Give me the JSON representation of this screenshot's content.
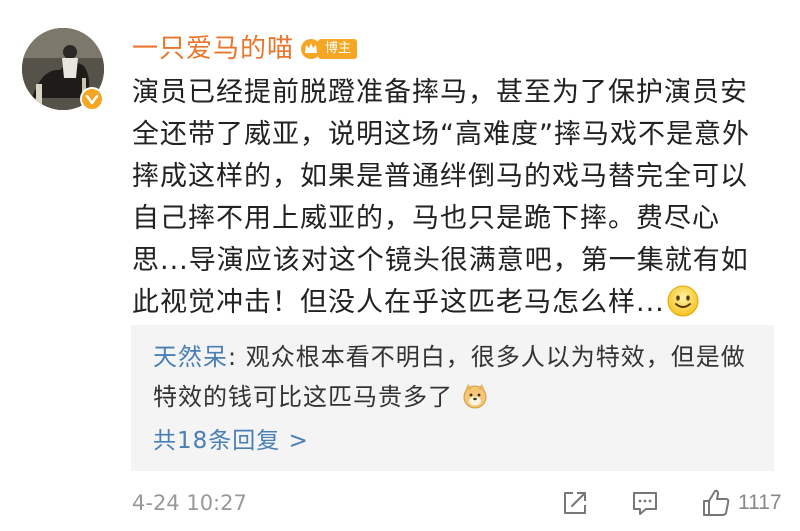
{
  "user": {
    "name": "一只爱马的喵",
    "badge_label": "博主"
  },
  "comment": {
    "text": "演员已经提前脱蹬准备摔马，甚至为了保护演员安全还带了威亚，说明这场“高难度”摔马戏不是意外摔成这样的，如果是普通绊倒马的戏马替完全可以自己摔不用上威亚的，马也只是跪下摔。费尽心思...导演应该对这个镜头很满意吧，第一集就有如此视觉冲击！但没人在乎这匹老马怎么样...",
    "emoji": "smile-icon"
  },
  "reply": {
    "author": "天然呆",
    "separator": ":",
    "text": " 观众根本看不明白，很多人以为特效，但是做特效的钱可比这匹马贵多了",
    "emoji": "doge-icon",
    "more_label": "共18条回复 >"
  },
  "footer": {
    "timestamp": "4-24 10:27",
    "like_count": "1117"
  },
  "colors": {
    "username": "#e8762b",
    "link": "#4a7fb5",
    "badge": "#f5a623",
    "reply_bg": "#f4f4f4"
  }
}
